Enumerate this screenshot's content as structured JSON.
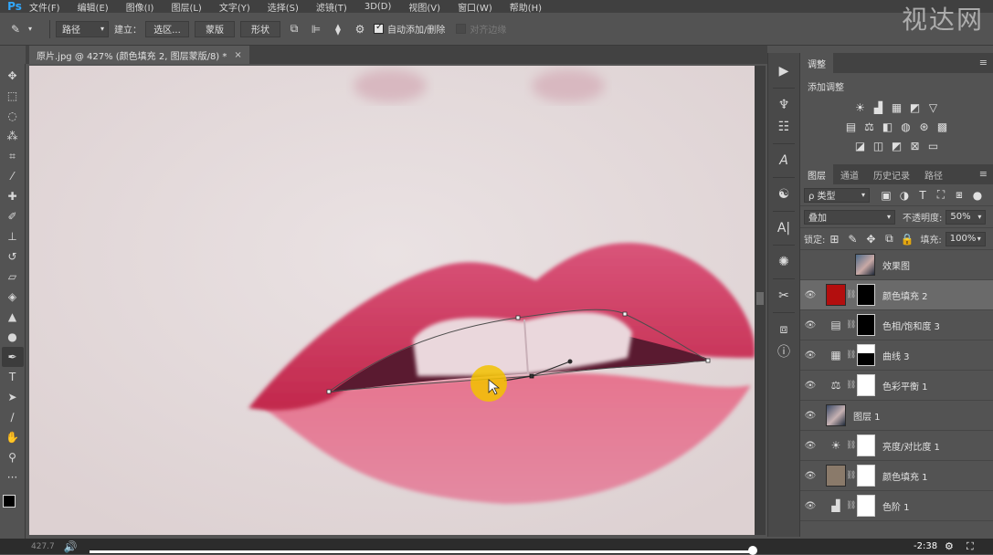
{
  "app": {
    "logo": "Ps"
  },
  "menu": [
    "文件(F)",
    "编辑(E)",
    "图像(I)",
    "图层(L)",
    "文字(Y)",
    "选择(S)",
    "滤镜(T)",
    "3D(D)",
    "视图(V)",
    "窗口(W)",
    "帮助(H)"
  ],
  "watermark": "视达网",
  "options": {
    "tool_mode": "路径",
    "make_label": "建立：",
    "selection_btn": "选区...",
    "mask_btn": "蒙版",
    "shape_btn": "形状",
    "auto_add_delete": "自动添加/删除",
    "align_edges": "对齐边缘"
  },
  "document": {
    "tab_title": "原片.jpg @ 427% (颜色填充 2, 图层蒙版/8) *",
    "close": "×",
    "zoom": "427.7"
  },
  "adjustments": {
    "tab": "调整",
    "title": "添加调整"
  },
  "layers_panel": {
    "tabs": [
      "图层",
      "通道",
      "历史记录",
      "路径"
    ],
    "filter_kind": "ρ 类型",
    "blend_mode": "叠加",
    "opacity_label": "不透明度:",
    "opacity_value": "50%",
    "lock_label": "锁定:",
    "fill_label": "填充:",
    "fill_value": "100%",
    "layers": [
      {
        "name": "效果图",
        "visible": false,
        "kind": "photo"
      },
      {
        "name": "颜色填充 2",
        "visible": true,
        "kind": "fill-red",
        "selected": true
      },
      {
        "name": "色相/饱和度 3",
        "visible": true,
        "kind": "adjust"
      },
      {
        "name": "曲线 3",
        "visible": true,
        "kind": "adjust"
      },
      {
        "name": "色彩平衡 1",
        "visible": true,
        "kind": "adjust"
      },
      {
        "name": "图层 1",
        "visible": true,
        "kind": "photo"
      },
      {
        "name": "亮度/对比度 1",
        "visible": true,
        "kind": "adjust"
      },
      {
        "name": "颜色填充 1",
        "visible": true,
        "kind": "fill-tan"
      },
      {
        "name": "色阶 1",
        "visible": true,
        "kind": "adjust"
      }
    ]
  },
  "player": {
    "time": "-2:38",
    "progress": 0.995
  },
  "colors": {
    "fill_red": "#b30e0e",
    "fill_tan": "#8a7a6a",
    "cursor_highlight": "#f2c200"
  }
}
